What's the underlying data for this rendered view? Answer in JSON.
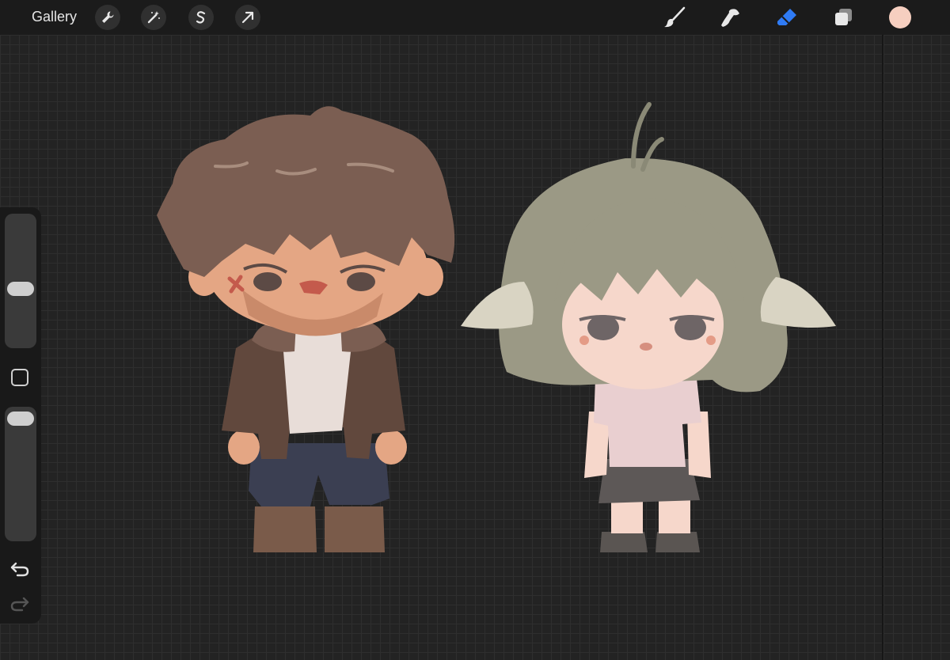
{
  "app": {
    "gallery_label": "Gallery",
    "left_tools": [
      "wrench-icon",
      "magic-wand-icon",
      "selection-s-icon",
      "transform-arrow-icon"
    ],
    "right_tools": [
      "brush-icon",
      "smudge-icon",
      "eraser-icon",
      "layers-icon"
    ],
    "active_tool": "eraser-icon",
    "current_color": "#f6cfc0",
    "accent_color": "#2f7bf5"
  },
  "sidebar": {
    "brush_size_level": 0.53,
    "opacity_level": 0.95,
    "controls": [
      "brush-size-slider",
      "modify-button",
      "opacity-slider",
      "undo-icon",
      "redo-icon"
    ]
  },
  "artwork": {
    "characters": [
      "man-with-brown-hair",
      "girl-with-gray-hair-and-ears"
    ],
    "palette": {
      "brown_hair": "#7b5e52",
      "skin": "#e4a684",
      "jacket": "#61483d",
      "shirt": "#e8ddd8",
      "pants": "#3b3f52",
      "boots": "#7a5b4a",
      "gray_hair": "#9b9985",
      "girl_skin": "#f6d7cb",
      "blouse": "#e9cfd0",
      "skirt": "#5d5857",
      "ears": "#d9d4c3"
    }
  }
}
